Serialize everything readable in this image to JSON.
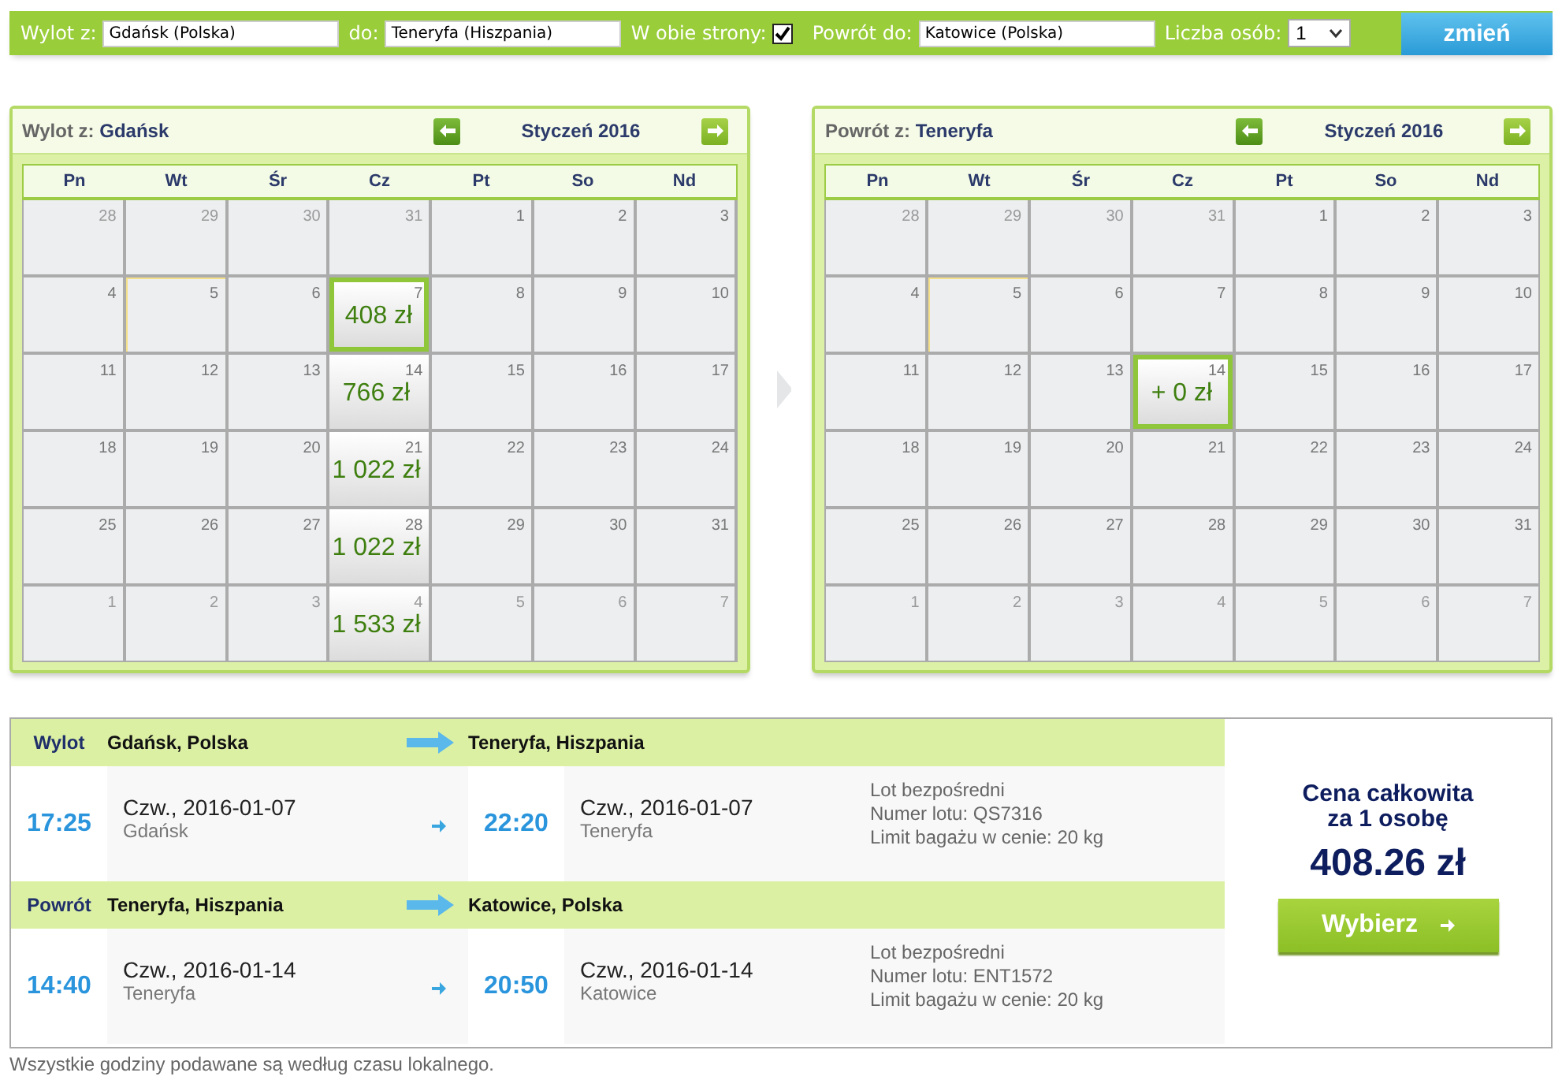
{
  "search_bar": {
    "from_label": "Wylot z:",
    "from_value": "Gdańsk (Polska)",
    "to_label": "do:",
    "to_value": "Teneryfa (Hiszpania)",
    "roundtrip_label": "W obie strony:",
    "roundtrip_checked": true,
    "return_label": "Powrót do:",
    "return_value": "Katowice (Polska)",
    "passengers_label": "Liczba osób:",
    "passengers_value": "1",
    "submit": "zmień"
  },
  "calendars": [
    {
      "label": "Wylot z:",
      "city": "Gdańsk",
      "month": "Styczeń 2016",
      "weekdays": [
        "Pn",
        "Wt",
        "Śr",
        "Cz",
        "Pt",
        "So",
        "Nd"
      ],
      "days": [
        {
          "day": "28",
          "muted": true,
          "today": false,
          "selected": false
        },
        {
          "day": "29",
          "muted": true,
          "today": false,
          "selected": false
        },
        {
          "day": "30",
          "muted": true,
          "today": false,
          "selected": false
        },
        {
          "day": "31",
          "muted": true,
          "today": false,
          "selected": false
        },
        {
          "day": "1",
          "muted": false,
          "today": false,
          "selected": false
        },
        {
          "day": "2",
          "muted": false,
          "today": false,
          "selected": false
        },
        {
          "day": "3",
          "muted": false,
          "today": false,
          "selected": false
        },
        {
          "day": "4",
          "muted": false,
          "today": false,
          "selected": false
        },
        {
          "day": "5",
          "muted": false,
          "today": true,
          "selected": false
        },
        {
          "day": "6",
          "muted": false,
          "today": false,
          "selected": false
        },
        {
          "day": "7",
          "muted": false,
          "today": false,
          "selected": true,
          "price": "408 zł"
        },
        {
          "day": "8",
          "muted": false,
          "today": false,
          "selected": false
        },
        {
          "day": "9",
          "muted": false,
          "today": false,
          "selected": false
        },
        {
          "day": "10",
          "muted": false,
          "today": false,
          "selected": false
        },
        {
          "day": "11",
          "muted": false,
          "today": false,
          "selected": false
        },
        {
          "day": "12",
          "muted": false,
          "today": false,
          "selected": false
        },
        {
          "day": "13",
          "muted": false,
          "today": false,
          "selected": false
        },
        {
          "day": "14",
          "muted": false,
          "today": false,
          "selected": false,
          "price": "766 zł"
        },
        {
          "day": "15",
          "muted": false,
          "today": false,
          "selected": false
        },
        {
          "day": "16",
          "muted": false,
          "today": false,
          "selected": false
        },
        {
          "day": "17",
          "muted": false,
          "today": false,
          "selected": false
        },
        {
          "day": "18",
          "muted": false,
          "today": false,
          "selected": false
        },
        {
          "day": "19",
          "muted": false,
          "today": false,
          "selected": false
        },
        {
          "day": "20",
          "muted": false,
          "today": false,
          "selected": false
        },
        {
          "day": "21",
          "muted": false,
          "today": false,
          "selected": false,
          "price": "1 022 zł"
        },
        {
          "day": "22",
          "muted": false,
          "today": false,
          "selected": false
        },
        {
          "day": "23",
          "muted": false,
          "today": false,
          "selected": false
        },
        {
          "day": "24",
          "muted": false,
          "today": false,
          "selected": false
        },
        {
          "day": "25",
          "muted": false,
          "today": false,
          "selected": false
        },
        {
          "day": "26",
          "muted": false,
          "today": false,
          "selected": false
        },
        {
          "day": "27",
          "muted": false,
          "today": false,
          "selected": false
        },
        {
          "day": "28",
          "muted": false,
          "today": false,
          "selected": false,
          "price": "1 022 zł"
        },
        {
          "day": "29",
          "muted": false,
          "today": false,
          "selected": false
        },
        {
          "day": "30",
          "muted": false,
          "today": false,
          "selected": false
        },
        {
          "day": "31",
          "muted": false,
          "today": false,
          "selected": false
        },
        {
          "day": "1",
          "muted": true,
          "today": false,
          "selected": false
        },
        {
          "day": "2",
          "muted": true,
          "today": false,
          "selected": false
        },
        {
          "day": "3",
          "muted": true,
          "today": false,
          "selected": false
        },
        {
          "day": "4",
          "muted": true,
          "today": false,
          "selected": false,
          "price": "1 533 zł"
        },
        {
          "day": "5",
          "muted": true,
          "today": false,
          "selected": false
        },
        {
          "day": "6",
          "muted": true,
          "today": false,
          "selected": false
        },
        {
          "day": "7",
          "muted": true,
          "today": false,
          "selected": false
        }
      ]
    },
    {
      "label": "Powrót z:",
      "city": "Teneryfa",
      "month": "Styczeń 2016",
      "weekdays": [
        "Pn",
        "Wt",
        "Śr",
        "Cz",
        "Pt",
        "So",
        "Nd"
      ],
      "days": [
        {
          "day": "28",
          "muted": true,
          "today": false,
          "selected": false
        },
        {
          "day": "29",
          "muted": true,
          "today": false,
          "selected": false
        },
        {
          "day": "30",
          "muted": true,
          "today": false,
          "selected": false
        },
        {
          "day": "31",
          "muted": true,
          "today": false,
          "selected": false
        },
        {
          "day": "1",
          "muted": false,
          "today": false,
          "selected": false
        },
        {
          "day": "2",
          "muted": false,
          "today": false,
          "selected": false
        },
        {
          "day": "3",
          "muted": false,
          "today": false,
          "selected": false
        },
        {
          "day": "4",
          "muted": false,
          "today": false,
          "selected": false
        },
        {
          "day": "5",
          "muted": false,
          "today": true,
          "selected": false
        },
        {
          "day": "6",
          "muted": false,
          "today": false,
          "selected": false
        },
        {
          "day": "7",
          "muted": false,
          "today": false,
          "selected": false
        },
        {
          "day": "8",
          "muted": false,
          "today": false,
          "selected": false
        },
        {
          "day": "9",
          "muted": false,
          "today": false,
          "selected": false
        },
        {
          "day": "10",
          "muted": false,
          "today": false,
          "selected": false
        },
        {
          "day": "11",
          "muted": false,
          "today": false,
          "selected": false
        },
        {
          "day": "12",
          "muted": false,
          "today": false,
          "selected": false
        },
        {
          "day": "13",
          "muted": false,
          "today": false,
          "selected": false
        },
        {
          "day": "14",
          "muted": false,
          "today": false,
          "selected": true,
          "price": "+ 0 zł"
        },
        {
          "day": "15",
          "muted": false,
          "today": false,
          "selected": false
        },
        {
          "day": "16",
          "muted": false,
          "today": false,
          "selected": false
        },
        {
          "day": "17",
          "muted": false,
          "today": false,
          "selected": false
        },
        {
          "day": "18",
          "muted": false,
          "today": false,
          "selected": false
        },
        {
          "day": "19",
          "muted": false,
          "today": false,
          "selected": false
        },
        {
          "day": "20",
          "muted": false,
          "today": false,
          "selected": false
        },
        {
          "day": "21",
          "muted": false,
          "today": false,
          "selected": false
        },
        {
          "day": "22",
          "muted": false,
          "today": false,
          "selected": false
        },
        {
          "day": "23",
          "muted": false,
          "today": false,
          "selected": false
        },
        {
          "day": "24",
          "muted": false,
          "today": false,
          "selected": false
        },
        {
          "day": "25",
          "muted": false,
          "today": false,
          "selected": false
        },
        {
          "day": "26",
          "muted": false,
          "today": false,
          "selected": false
        },
        {
          "day": "27",
          "muted": false,
          "today": false,
          "selected": false
        },
        {
          "day": "28",
          "muted": false,
          "today": false,
          "selected": false
        },
        {
          "day": "29",
          "muted": false,
          "today": false,
          "selected": false
        },
        {
          "day": "30",
          "muted": false,
          "today": false,
          "selected": false
        },
        {
          "day": "31",
          "muted": false,
          "today": false,
          "selected": false
        },
        {
          "day": "1",
          "muted": true,
          "today": false,
          "selected": false
        },
        {
          "day": "2",
          "muted": true,
          "today": false,
          "selected": false
        },
        {
          "day": "3",
          "muted": true,
          "today": false,
          "selected": false
        },
        {
          "day": "4",
          "muted": true,
          "today": false,
          "selected": false
        },
        {
          "day": "5",
          "muted": true,
          "today": false,
          "selected": false
        },
        {
          "day": "6",
          "muted": true,
          "today": false,
          "selected": false
        },
        {
          "day": "7",
          "muted": true,
          "today": false,
          "selected": false
        }
      ]
    }
  ],
  "summary": {
    "legs": [
      {
        "label": "Wylot",
        "from": "Gdańsk, Polska",
        "to": "Teneryfa, Hiszpania",
        "depart_time": "17:25",
        "depart_date": "Czw., 2016-01-07",
        "depart_city": "Gdańsk",
        "arrive_time": "22:20",
        "arrive_date": "Czw., 2016-01-07",
        "arrive_city": "Teneryfa",
        "details": [
          "Lot bezpośredni",
          "Numer lotu: QS7316",
          "Limit bagażu w cenie: 20 kg"
        ]
      },
      {
        "label": "Powrót",
        "from": "Teneryfa, Hiszpania",
        "to": "Katowice, Polska",
        "depart_time": "14:40",
        "depart_date": "Czw., 2016-01-14",
        "depart_city": "Teneryfa",
        "arrive_time": "20:50",
        "arrive_date": "Czw., 2016-01-14",
        "arrive_city": "Katowice",
        "details": [
          "Lot bezpośredni",
          "Numer lotu: ENT1572",
          "Limit bagażu w cenie: 20 kg"
        ]
      }
    ],
    "price_title": [
      "Cena całkowita",
      "za 1 osobę"
    ],
    "price": "408.26 zł",
    "button": "Wybierz"
  },
  "footnote": "Wszystkie godziny podawane są według czasu lokalnego."
}
